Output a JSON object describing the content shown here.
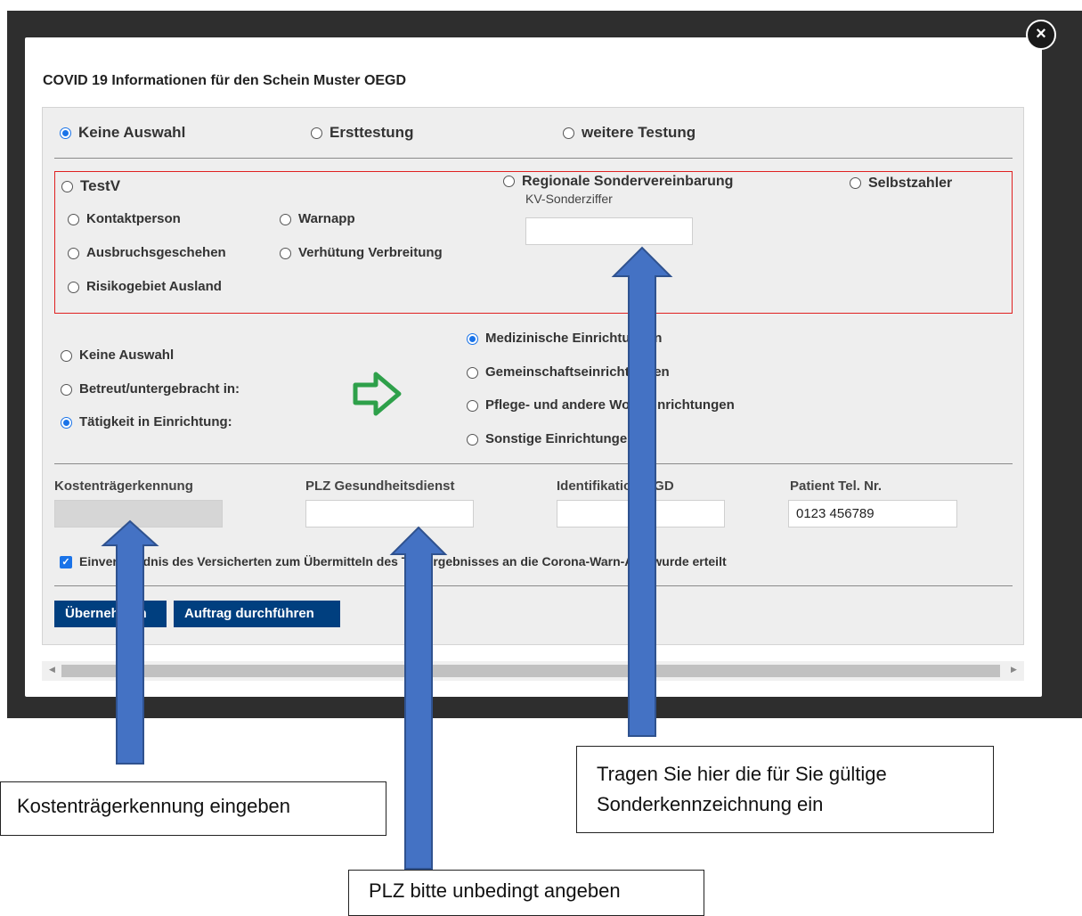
{
  "modal": {
    "title": "COVID 19 Informationen für den Schein Muster OEGD",
    "close_icon": "close-icon"
  },
  "testing_type": {
    "options": [
      "Keine Auswahl",
      "Ersttestung",
      "weitere Testung"
    ],
    "selected": "Keine Auswahl"
  },
  "billing": {
    "testv": "TestV",
    "testv_reasons": [
      "Kontaktperson",
      "Warnapp",
      "Ausbruchsgeschehen",
      "Verhütung Verbreitung",
      "Risikogebiet Ausland"
    ],
    "regional": "Regionale Sondervereinbarung",
    "kv_label": "KV-Sonderziffer",
    "kv_value": "",
    "self_pay": "Selbstzahler"
  },
  "facility_status": {
    "options": [
      "Keine Auswahl",
      "Betreut/untergebracht in:",
      "Tätigkeit in Einrichtung:"
    ],
    "selected": "Tätigkeit in Einrichtung:"
  },
  "facility_type": {
    "options": [
      "Medizinische Einrichtungen",
      "Gemeinschaftseinrichtungen",
      "Pflege- und andere Wohneinrichtungen",
      "Sonstige Einrichtungen"
    ],
    "selected": "Medizinische Einrichtungen"
  },
  "fields": {
    "cost_label": "Kostenträgerkennung",
    "cost_value": "",
    "plz_label": "PLZ Gesundheitsdienst",
    "plz_value": "",
    "oegd_label": "Identifikation ÖGD",
    "oegd_value": "",
    "phone_label": "Patient Tel. Nr.",
    "phone_value": "0123 456789"
  },
  "consent": {
    "checked": true,
    "label": "Einverständnis des Versicherten zum Übermitteln des Testergebnisses an die Corona-Warn-App wurde erteilt"
  },
  "buttons": {
    "apply": "Übernehmen",
    "execute": "Auftrag durchführen"
  },
  "annotations": {
    "cost_hint": "Kostenträgerkennung eingeben",
    "plz_hint": "PLZ bitte unbedingt angeben",
    "kv_hint_line1": "Tragen Sie hier die für Sie gültige",
    "kv_hint_line2": "Sonderkennzeichnung ein"
  },
  "colors": {
    "accent": "#1a73e8",
    "button": "#003f7f",
    "arrow_fill": "#4472c4",
    "arrow_stroke": "#2f528f",
    "green_arrow": "#2ea04a",
    "red_border": "#e02020"
  }
}
